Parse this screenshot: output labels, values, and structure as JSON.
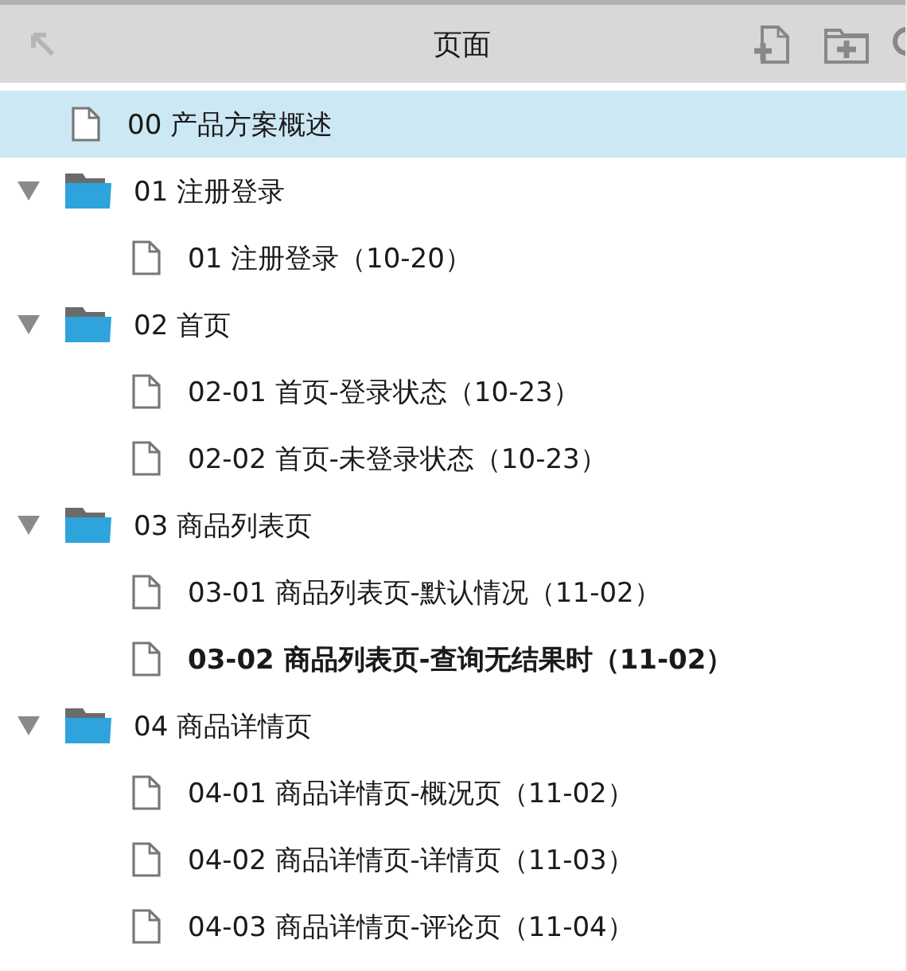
{
  "header": {
    "title": "页面"
  },
  "items": [
    {
      "kind": "page",
      "label": "00 产品方案概述",
      "selected": true,
      "current": false
    },
    {
      "kind": "folder",
      "label": "01 注册登录",
      "selected": false,
      "expanded": true,
      "children": [
        {
          "kind": "page",
          "label": "01 注册登录（10-20）",
          "selected": false,
          "current": false
        }
      ]
    },
    {
      "kind": "folder",
      "label": "02 首页",
      "selected": false,
      "expanded": true,
      "children": [
        {
          "kind": "page",
          "label": "02-01 首页-登录状态（10-23）",
          "selected": false,
          "current": false
        },
        {
          "kind": "page",
          "label": "02-02 首页-未登录状态（10-23）",
          "selected": false,
          "current": false
        }
      ]
    },
    {
      "kind": "folder",
      "label": "03 商品列表页",
      "selected": false,
      "expanded": true,
      "children": [
        {
          "kind": "page",
          "label": "03-01 商品列表页-默认情况（11-02）",
          "selected": false,
          "current": false
        },
        {
          "kind": "page",
          "label": "03-02 商品列表页-查询无结果时（11-02）",
          "selected": false,
          "current": true
        }
      ]
    },
    {
      "kind": "folder",
      "label": "04 商品详情页",
      "selected": false,
      "expanded": true,
      "children": [
        {
          "kind": "page",
          "label": "04-01 商品详情页-概况页（11-02）",
          "selected": false,
          "current": false
        },
        {
          "kind": "page",
          "label": "04-02 商品详情页-详情页（11-03）",
          "selected": false,
          "current": false
        },
        {
          "kind": "page",
          "label": "04-03 商品详情页-评论页（11-04）",
          "selected": false,
          "current": false
        }
      ]
    }
  ]
}
